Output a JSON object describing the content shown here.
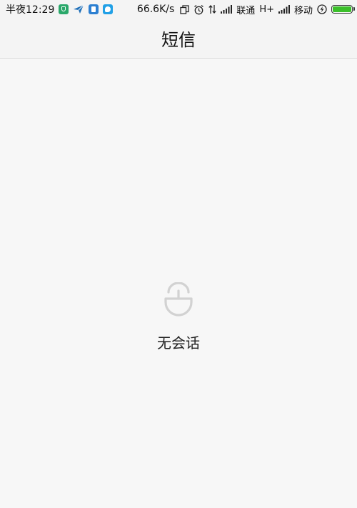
{
  "status_bar": {
    "time": "半夜12:29",
    "speed": "66.6K/s",
    "carrier1": "联通",
    "network_type": "H+",
    "carrier2": "移动",
    "battery_level": 1.0,
    "colors": {
      "battery_fill": "#3bbf2a",
      "shield_app": "#2aa86a",
      "blue_app": "#2c7fd1",
      "cyan_app": "#21a0e6"
    },
    "icons": [
      "shield-app-icon",
      "bird-app-icon",
      "blue-app-icon",
      "chat-app-icon",
      "copy-icon",
      "alarm-icon",
      "data-arrows-icon",
      "signal-icon",
      "battery-icon",
      "charging-icon"
    ]
  },
  "header": {
    "title": "短信"
  },
  "empty_state": {
    "icon": "unlocked-bag-icon",
    "message": "无会话"
  }
}
